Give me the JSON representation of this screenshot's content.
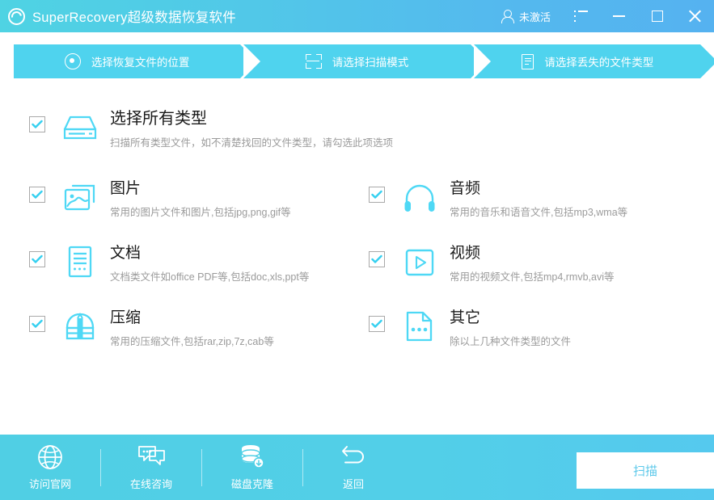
{
  "titlebar": {
    "app_title": "SuperRecovery超级数据恢复软件",
    "logo_icon": "spiral-logo-icon",
    "account_status": "未激活",
    "account_icon": "user-icon",
    "menu_icon": "list-menu-icon",
    "minimize_icon": "minimize-icon",
    "maximize_icon": "maximize-icon",
    "close_icon": "close-icon",
    "gradient_from": "#4fd3e3",
    "gradient_to": "#55b2f0"
  },
  "steps": {
    "active_color": "#4fd3ee",
    "items": [
      {
        "label": "选择恢复文件的位置",
        "icon": "target-icon"
      },
      {
        "label": "请选择扫描模式",
        "icon": "scan-frame-icon"
      },
      {
        "label": "请选择丢失的文件类型",
        "icon": "document-icon"
      }
    ]
  },
  "file_types": {
    "accent_color": "#4ed8f5",
    "select_all": {
      "title": "选择所有类型",
      "desc": "扫描所有类型文件，如不清楚找回的文件类型，请勾选此项选项",
      "icon": "hard-drive-icon",
      "checked": true
    },
    "items": [
      {
        "title": "图片",
        "desc": "常用的图片文件和图片,包括jpg,png,gif等",
        "icon": "picture-icon",
        "checked": true
      },
      {
        "title": "音频",
        "desc": "常用的音乐和语音文件,包括mp3,wma等",
        "icon": "headphone-icon",
        "checked": true
      },
      {
        "title": "文档",
        "desc": "文档类文件如office PDF等,包括doc,xls,ppt等",
        "icon": "document-icon",
        "checked": true
      },
      {
        "title": "视频",
        "desc": "常用的视频文件,包括mp4,rmvb,avi等",
        "icon": "play-video-icon",
        "checked": true
      },
      {
        "title": "压缩",
        "desc": "常用的压缩文件,包括rar,zip,7z,cab等",
        "icon": "archive-icon",
        "checked": true
      },
      {
        "title": "其它",
        "desc": "除以上几种文件类型的文件",
        "icon": "other-file-icon",
        "checked": true
      }
    ]
  },
  "footer": {
    "background_color": "#52d0e6",
    "buttons": [
      {
        "label": "访问官网",
        "icon": "globe-icon"
      },
      {
        "label": "在线咨询",
        "icon": "chat-icon"
      },
      {
        "label": "磁盘克隆",
        "icon": "database-clone-icon"
      },
      {
        "label": "返回",
        "icon": "back-arrow-icon"
      }
    ],
    "scan_button": {
      "label": "扫描",
      "text_color": "#5bc8ea"
    }
  }
}
